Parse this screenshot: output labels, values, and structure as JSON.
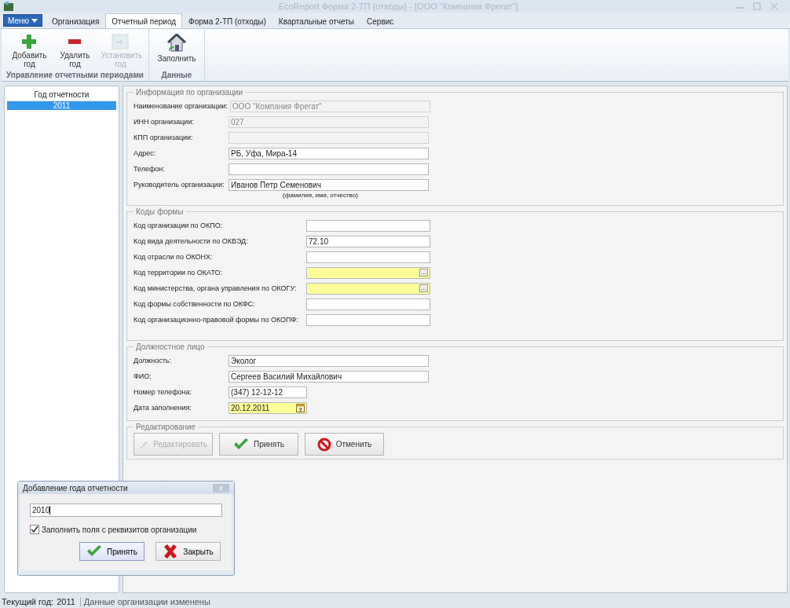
{
  "window": {
    "title": "EcoReport Форма 2-ТП (отходы) - [ООО \"Компания Фрегат\"]"
  },
  "menu_button": {
    "label": "Меню"
  },
  "tabs": [
    {
      "label": "Организация",
      "selected": false
    },
    {
      "label": "Отчетный период",
      "selected": true
    },
    {
      "label": "Форма 2-ТП (отходы)",
      "selected": false
    },
    {
      "label": "Квартальные отчеты",
      "selected": false
    },
    {
      "label": "Сервис",
      "selected": false
    }
  ],
  "ribbon_groups": [
    {
      "title": "Управление отчетными периодами",
      "buttons": [
        {
          "label": "Добавить год",
          "kind": "add",
          "disabled": false
        },
        {
          "label": "Удалить год",
          "kind": "remove",
          "disabled": false
        },
        {
          "label": "Установить год",
          "kind": "set",
          "disabled": true
        }
      ]
    },
    {
      "title": "Данные",
      "buttons": [
        {
          "label": "Заполнить",
          "kind": "fill",
          "disabled": false
        }
      ]
    }
  ],
  "year_list": {
    "header": "Год отчетности",
    "items": [
      {
        "label": "2011",
        "selected": true
      }
    ]
  },
  "sections": [
    {
      "title": "Информация по организации",
      "fields": [
        {
          "label": "Наименование организации:",
          "value": "ООО \"Компания Фрегат\"",
          "kind": "text",
          "disabled": true,
          "required": false
        },
        {
          "label": "ИНН организации:",
          "value": "027",
          "kind": "text",
          "disabled": true,
          "required": false
        },
        {
          "label": "КПП организации:",
          "kind": "text",
          "disabled": true,
          "required": false
        },
        {
          "label": "Адрес:",
          "value": "РБ, Уфа, Мира-14",
          "kind": "text",
          "disabled": false,
          "required": false
        },
        {
          "label": "Телефон:",
          "kind": "text",
          "disabled": false,
          "required": false
        },
        {
          "label": "Руководитель организации:",
          "value": "Иванов Петр Семенович",
          "kind": "text",
          "disabled": false,
          "required": false,
          "hint": "(фамилия, имя, отчество)"
        }
      ]
    },
    {
      "title": "Коды формы",
      "fields": [
        {
          "label": "Код организации по ОКПО:",
          "kind": "text",
          "disabled": false,
          "required": false
        },
        {
          "label": "Код вида деятельности по ОКВЭД:",
          "value": "72.10",
          "kind": "text",
          "disabled": false,
          "required": false
        },
        {
          "label": "Код отрасли по ОКОНХ:",
          "kind": "text",
          "disabled": false,
          "required": false
        },
        {
          "label": "Код территории по ОКАТО:",
          "kind": "lookup",
          "disabled": false,
          "required": true,
          "button": "..."
        },
        {
          "label": "Код министерства, органа управления по ОКОГУ:",
          "kind": "lookup",
          "disabled": false,
          "required": true,
          "button": "..."
        },
        {
          "label": "Код формы собственности по ОКФС:",
          "kind": "text",
          "disabled": false,
          "required": false
        },
        {
          "label": "Код организационно-правовой формы по ОКОПФ:",
          "kind": "text",
          "disabled": false,
          "required": false
        }
      ]
    },
    {
      "title": "Должностное лицо",
      "fields": [
        {
          "label": "Должность:",
          "value": "Эколог",
          "kind": "text",
          "disabled": false,
          "required": false
        },
        {
          "label": "ФИО:",
          "value": "Сергеев Василий Михайлович",
          "kind": "text",
          "disabled": false,
          "required": false
        },
        {
          "label": "Номер телефона:",
          "value": "(347) 12-12-12",
          "kind": "short",
          "disabled": false,
          "required": false
        },
        {
          "label": "Дата заполнения:",
          "value": "20.12.2011",
          "kind": "date",
          "disabled": false,
          "required": true
        }
      ]
    }
  ],
  "edit_section": {
    "title": "Редактирование",
    "buttons": [
      {
        "label": "Редактировать",
        "kind": "edit",
        "disabled": true
      },
      {
        "label": "Принять",
        "kind": "accept",
        "disabled": false
      },
      {
        "label": "Отменить",
        "kind": "cancel",
        "disabled": false
      }
    ]
  },
  "dialog": {
    "title": "Добавление года отчетности",
    "close": "x",
    "value": "2010",
    "checkbox": {
      "label": "Заполнить поля с реквизитов организации",
      "checked": true
    },
    "buttons": [
      {
        "label": "Принять",
        "kind": "accept",
        "selected": true
      },
      {
        "label": "Закрыть",
        "kind": "close",
        "selected": false
      }
    ]
  },
  "status_bar": {
    "label": "Текущий год:",
    "year": "2011",
    "message": "Данные организации изменены"
  }
}
